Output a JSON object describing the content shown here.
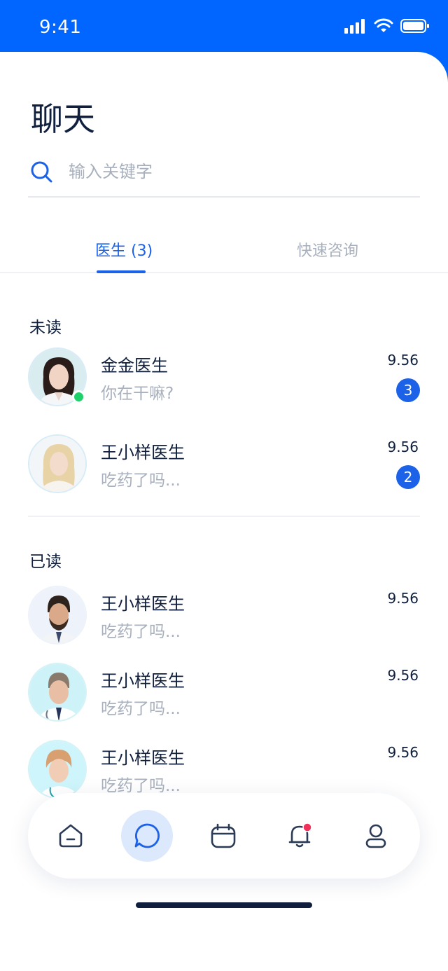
{
  "status_bar": {
    "time": "9:41"
  },
  "page": {
    "title": "聊天"
  },
  "search": {
    "placeholder": "输入关键字"
  },
  "tabs": [
    {
      "label": "医生 (3)",
      "active": true
    },
    {
      "label": "快速咨询",
      "active": false
    }
  ],
  "sections": {
    "unread_label": "未读",
    "read_label": "已读"
  },
  "unread_chats": [
    {
      "name": "金金医生",
      "message": "你在干嘛?",
      "time": "9.56",
      "badge": "3",
      "online": true
    },
    {
      "name": "王小样医生",
      "message": "吃药了吗...",
      "time": "9.56",
      "badge": "2",
      "online": false
    }
  ],
  "read_chats": [
    {
      "name": "王小样医生",
      "message": "吃药了吗...",
      "time": "9.56"
    },
    {
      "name": "王小样医生",
      "message": "吃药了吗...",
      "time": "9.56"
    },
    {
      "name": "王小样医生",
      "message": "吃药了吗...",
      "time": "9.56"
    }
  ],
  "bottom_nav": [
    {
      "icon": "home-icon",
      "active": false
    },
    {
      "icon": "chat-icon",
      "active": true
    },
    {
      "icon": "calendar-icon",
      "active": false
    },
    {
      "icon": "bell-icon",
      "active": false,
      "has_notification": true
    },
    {
      "icon": "profile-icon",
      "active": false
    }
  ],
  "colors": {
    "brand": "#0066ff",
    "accent": "#1b62e8",
    "online": "#1fd16a",
    "notification": "#f0315a",
    "text": "#0f1f3d",
    "muted": "#a8b0bd"
  }
}
